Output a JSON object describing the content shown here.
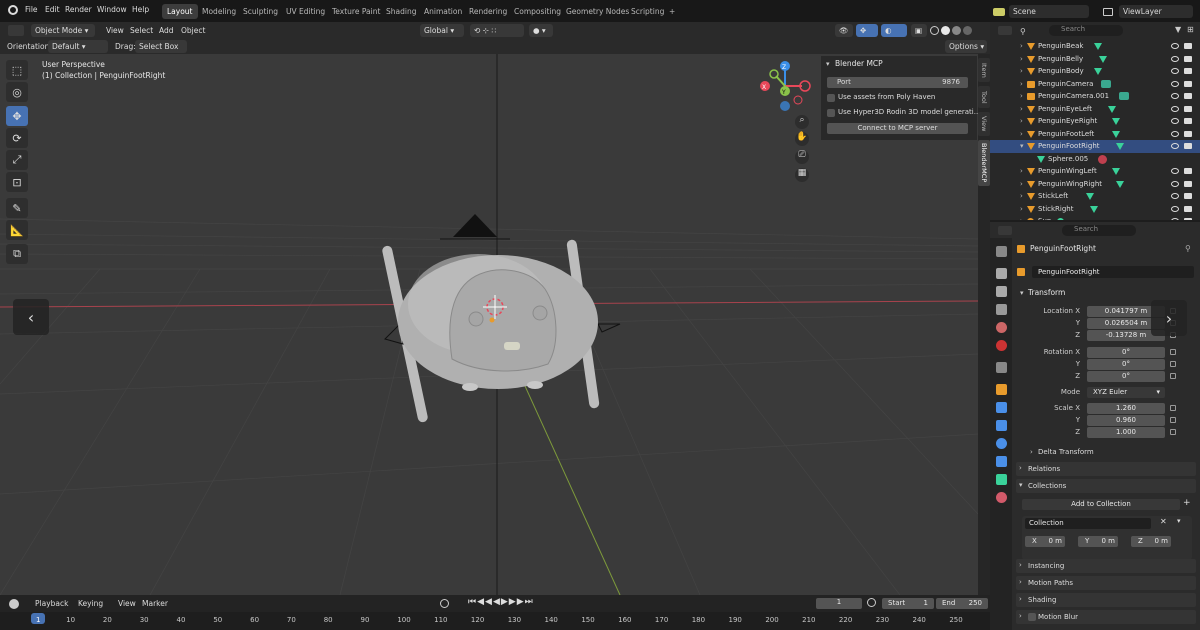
{
  "menubar": {
    "items": [
      "File",
      "Edit",
      "Render",
      "Window",
      "Help"
    ],
    "workspaces": [
      "Layout",
      "Modeling",
      "Sculpting",
      "UV Editing",
      "Texture Paint",
      "Shading",
      "Animation",
      "Rendering",
      "Compositing",
      "Geometry Nodes",
      "Scripting"
    ],
    "active_workspace": "Layout",
    "add_tab": "+",
    "scene": "Scene",
    "view_layer": "ViewLayer"
  },
  "header": {
    "mode": "Object Mode",
    "view": "View",
    "select": "Select",
    "add": "Add",
    "object": "Object",
    "transform_orientation": "Global"
  },
  "tool_settings": {
    "orientation_label": "Orientation:",
    "orientation_value": "Default",
    "drag_label": "Drag:",
    "drag_value": "Select Box",
    "options": "Options"
  },
  "viewport": {
    "perspective": "User Perspective",
    "collection_info": "(1) Collection | PenguinFootRight",
    "nav_left": "‹",
    "nav_right": "›",
    "gizmo": {
      "x": "X",
      "y": "Y",
      "z": "Z"
    }
  },
  "mcp_panel": {
    "title": "Blender MCP",
    "port_label": "Port",
    "port_value": "9876",
    "poly_haven": "Use assets from Poly Haven",
    "hyper3d": "Use Hyper3D Rodin 3D model generati...",
    "connect": "Connect to MCP server"
  },
  "side_tabs": [
    "Item",
    "Tool",
    "View",
    "BlenderMCP"
  ],
  "outliner": {
    "search_placeholder": "Search",
    "rows": [
      {
        "name": "PenguinBeak"
      },
      {
        "name": "PenguinBelly"
      },
      {
        "name": "PenguinBody"
      },
      {
        "name": "PenguinCamera"
      },
      {
        "name": "PenguinCamera.001"
      },
      {
        "name": "PenguinEyeLeft"
      },
      {
        "name": "PenguinEyeRight"
      },
      {
        "name": "PenguinFootLeft"
      },
      {
        "name": "PenguinFootRight"
      },
      {
        "name": "Sphere.005"
      },
      {
        "name": "PenguinWingLeft"
      },
      {
        "name": "PenguinWingRight"
      },
      {
        "name": "StickLeft"
      },
      {
        "name": "StickRight"
      },
      {
        "name": "Sun"
      }
    ]
  },
  "properties": {
    "search_placeholder": "Search",
    "object_name": "PenguinFootRight",
    "data_name": "PenguinFootRight",
    "transform": "Transform",
    "location_x_label": "Location X",
    "y_label": "Y",
    "z_label": "Z",
    "location": [
      "0.041797 m",
      "0.026504 m",
      "-0.13728 m"
    ],
    "rotation_x_label": "Rotation X",
    "rotation": [
      "0°",
      "0°",
      "0°"
    ],
    "mode_label": "Mode",
    "mode_value": "XYZ Euler",
    "scale_x_label": "Scale X",
    "scale": [
      "1.260",
      "0.960",
      "1.000"
    ],
    "delta_transform": "Delta Transform",
    "relations": "Relations",
    "collections": "Collections",
    "add_to_collection": "Add to Collection",
    "collection_name": "Collection",
    "offset_x_label": "X",
    "offset_y_label": "Y",
    "offset_z_label": "Z",
    "offset_x": "0 m",
    "offset_y": "0 m",
    "offset_z": "0 m",
    "instancing": "Instancing",
    "motion_paths": "Motion Paths",
    "shading": "Shading",
    "motion_blur": "Motion Blur"
  },
  "timeline": {
    "playback": "Playback",
    "keying": "Keying",
    "view": "View",
    "marker": "Marker",
    "current_frame": "1",
    "start_label": "Start",
    "start": "1",
    "end_label": "End",
    "end": "250",
    "ruler": [
      "1",
      "10",
      "20",
      "30",
      "40",
      "50",
      "60",
      "70",
      "80",
      "90",
      "100",
      "110",
      "120",
      "130",
      "140",
      "150",
      "160",
      "170",
      "180",
      "190",
      "200",
      "210",
      "220",
      "230",
      "240",
      "250"
    ]
  },
  "colors": {
    "accent": "#4772b3",
    "selection": "#334d80",
    "object_orange": "#e89b2c",
    "mesh_green": "#3ad29a",
    "x_axis": "#e8485a",
    "y_axis": "#8bc34a",
    "z_axis": "#3b8fe8"
  }
}
